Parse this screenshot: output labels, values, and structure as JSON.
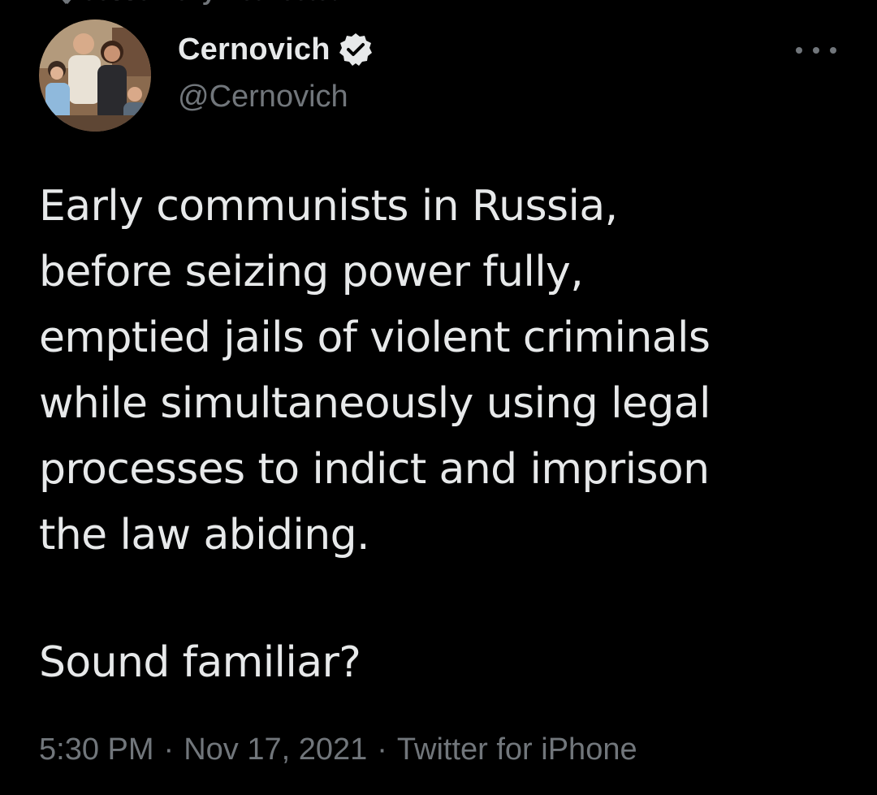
{
  "retweet": {
    "label": "Jesse Kelly Retweeted",
    "icon": "retweet-icon"
  },
  "author": {
    "display_name": "Cernovich",
    "handle": "@Cernovich",
    "verified": true,
    "verified_icon": "verified-badge-icon",
    "avatar": "profile-photo"
  },
  "menu": {
    "icon": "more-options-icon"
  },
  "tweet": {
    "body": "Early communists in Russia,\nbefore seizing power fully,\nemptied jails of violent criminals\nwhile simultaneously using legal\nprocesses to indict and imprison\nthe law abiding.",
    "closing": "Sound familiar?"
  },
  "meta": {
    "time": "5:30 PM",
    "separator": "·",
    "date": "Nov 17, 2021",
    "source": "Twitter for iPhone"
  },
  "colors": {
    "background": "#000000",
    "primary_text": "#e7e9ea",
    "secondary_text": "#71767b"
  }
}
